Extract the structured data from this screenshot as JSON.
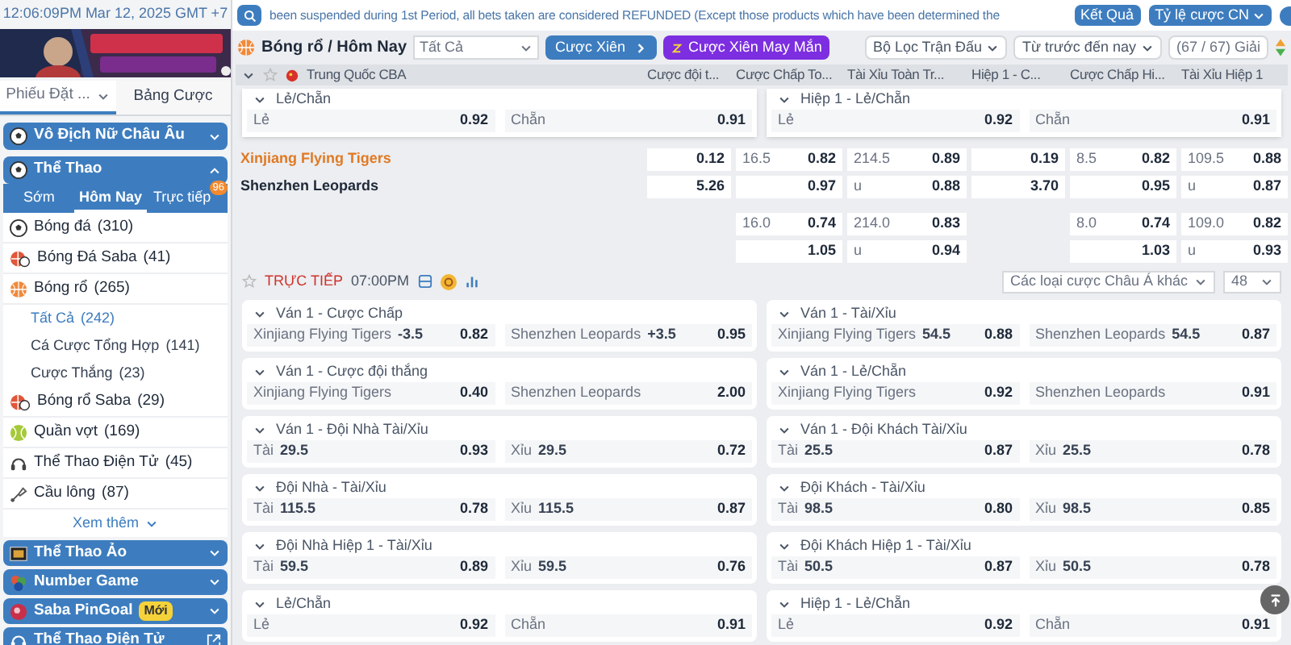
{
  "sidebar": {
    "clock": "12:06:09PM Mar 12, 2025 GMT +7",
    "tabs": [
      {
        "label": "Phiếu Đặt ...",
        "selected": true,
        "kind": "dropdown"
      },
      {
        "label": "Bảng Cược",
        "selected": false,
        "kind": "plain"
      }
    ],
    "sections": [
      {
        "title": "Vô Địch Nữ Châu Âu",
        "expanded": false
      },
      {
        "title": "Thể Thao",
        "expanded": true
      }
    ],
    "sport_tabs": [
      {
        "label": "Sớm",
        "selected": false
      },
      {
        "label": "Hôm Nay",
        "selected": true
      },
      {
        "label": "Trực tiếp",
        "selected": false,
        "badge": "96"
      }
    ],
    "sports": [
      {
        "name": "Bóng đá",
        "count": "(310)",
        "kind": "soccer"
      },
      {
        "name": "Bóng Đá Saba",
        "count": "(41)",
        "kind": "saba"
      },
      {
        "name": "Bóng rổ",
        "count": "(265)",
        "kind": "basketball",
        "children": [
          {
            "name": "Tất Cả",
            "count": "(242)",
            "selected": true
          },
          {
            "name": "Cá Cược Tổng Hợp",
            "count": "(141)",
            "selected": false
          },
          {
            "name": "Cược Thắng",
            "count": "(23)",
            "selected": false
          }
        ]
      },
      {
        "name": "Bóng rổ Saba",
        "count": "(29)",
        "kind": "saba"
      },
      {
        "name": "Quần vợt",
        "count": "(169)",
        "kind": "tennis"
      },
      {
        "name": "Thể Thao Điện Tử",
        "count": "(45)",
        "kind": "esports"
      },
      {
        "name": "Cầu lông",
        "count": "(87)",
        "kind": "badminton"
      }
    ],
    "more": "Xem thêm",
    "groups": [
      {
        "title": "Thể Thao Ảo",
        "kind": "collapsible"
      },
      {
        "title": "Number Game",
        "kind": "collapsible"
      },
      {
        "title": "Saba PinGoal",
        "kind": "collapsible",
        "badge": "Mới"
      },
      {
        "title": "Thể Thao Điện Tử",
        "kind": "link"
      }
    ]
  },
  "notice": "been suspended during 1st Period, all bets taken are considered REFUNDED (Except those products which have been determined the",
  "top_buttons": [
    {
      "label": "Kết Quả",
      "kind": "plain"
    },
    {
      "label": "Tỷ lệ cược CN",
      "kind": "dropdown"
    }
  ],
  "toolbar": {
    "title": "Bóng rổ / Hôm Nay",
    "sport_filter": "Tất Cả",
    "parlay": "Cược Xiên",
    "lucky_parlay": "Cược Xiên May Mắn",
    "match_filter": "Bộ Lọc Trận Đấu",
    "period": "Từ trước đến nay",
    "league_count": "(67 / 67) Giải"
  },
  "league": {
    "name": "Trung Quốc CBA",
    "columns": [
      "Cược đội t...",
      "Cược Chấp To...",
      "Tài Xỉu Toàn Tr...",
      "Hiệp 1 - C...",
      "Cược Chấp Hi...",
      "Tài Xỉu Hiệp 1"
    ]
  },
  "popup_markets": [
    {
      "title": "Lẻ/Chẵn",
      "outcomes": [
        {
          "label": "Lẻ",
          "odds": "0.92"
        },
        {
          "label": "Chẵn",
          "odds": "0.91"
        }
      ]
    },
    {
      "title": "Hiệp 1 - Lẻ/Chẵn",
      "outcomes": [
        {
          "label": "Lẻ",
          "odds": "0.92"
        },
        {
          "label": "Chẵn",
          "odds": "0.91"
        }
      ]
    }
  ],
  "match": {
    "teams": [
      {
        "name": "Xinjiang Flying Tigers",
        "favorite": true
      },
      {
        "name": "Shenzhen Leopards",
        "favorite": false
      }
    ],
    "rows": [
      [
        {
          "odds": "0.12"
        },
        {
          "line": "16.5",
          "odds": "0.82"
        },
        {
          "line": "214.5",
          "odds": "0.89"
        },
        {
          "odds": "0.19"
        },
        {
          "line": "8.5",
          "odds": "0.82"
        },
        {
          "line": "109.5",
          "odds": "0.88"
        }
      ],
      [
        {
          "odds": "5.26"
        },
        {
          "odds": "0.97"
        },
        {
          "line": "u",
          "odds": "0.88"
        },
        {
          "odds": "3.70"
        },
        {
          "odds": "0.95"
        },
        {
          "line": "u",
          "odds": "0.87"
        }
      ],
      [
        {},
        {
          "line": "16.0",
          "odds": "0.74"
        },
        {
          "line": "214.0",
          "odds": "0.83"
        },
        {},
        {
          "line": "8.0",
          "odds": "0.74"
        },
        {
          "line": "109.0",
          "odds": "0.82"
        }
      ],
      [
        {},
        {
          "odds": "1.05"
        },
        {
          "line": "u",
          "odds": "0.94"
        },
        {},
        {
          "odds": "1.03"
        },
        {
          "line": "u",
          "odds": "0.93"
        }
      ]
    ]
  },
  "live": {
    "status": "TRỰC TIẾP",
    "time": "07:00PM",
    "market_filter": "Các loại cược Châu Á khác",
    "count": "48"
  },
  "markets": [
    {
      "title": "Ván 1 - Cược Chấp",
      "outcomes": [
        {
          "label": "Xinjiang Flying Tigers",
          "line": "-3.5",
          "odds": "0.82"
        },
        {
          "label": "Shenzhen Leopards",
          "line": "+3.5",
          "odds": "0.95"
        }
      ]
    },
    {
      "title": "Ván 1 - Tài/Xỉu",
      "outcomes": [
        {
          "label": "Xinjiang Flying Tigers",
          "line": "54.5",
          "odds": "0.88"
        },
        {
          "label": "Shenzhen Leopards",
          "line": "54.5",
          "odds": "0.87"
        }
      ]
    },
    {
      "title": "Ván 1 - Cược đội thắng",
      "outcomes": [
        {
          "label": "Xinjiang Flying Tigers",
          "odds": "0.40"
        },
        {
          "label": "Shenzhen Leopards",
          "odds": "2.00"
        }
      ]
    },
    {
      "title": "Ván 1 - Lẻ/Chẵn",
      "outcomes": [
        {
          "label": "Xinjiang Flying Tigers",
          "odds": "0.92"
        },
        {
          "label": "Shenzhen Leopards",
          "odds": "0.91"
        }
      ]
    },
    {
      "title": "Ván 1 - Đội Nhà Tài/Xỉu",
      "outcomes": [
        {
          "label": "Tài",
          "line": "29.5",
          "odds": "0.93"
        },
        {
          "label": "Xỉu",
          "line": "29.5",
          "odds": "0.72"
        }
      ]
    },
    {
      "title": "Ván 1 - Đội Khách Tài/Xỉu",
      "outcomes": [
        {
          "label": "Tài",
          "line": "25.5",
          "odds": "0.87"
        },
        {
          "label": "Xỉu",
          "line": "25.5",
          "odds": "0.78"
        }
      ]
    },
    {
      "title": "Đội Nhà - Tài/Xỉu",
      "outcomes": [
        {
          "label": "Tài",
          "line": "115.5",
          "odds": "0.78"
        },
        {
          "label": "Xỉu",
          "line": "115.5",
          "odds": "0.87"
        }
      ]
    },
    {
      "title": "Đội Khách - Tài/Xỉu",
      "outcomes": [
        {
          "label": "Tài",
          "line": "98.5",
          "odds": "0.80"
        },
        {
          "label": "Xỉu",
          "line": "98.5",
          "odds": "0.85"
        }
      ]
    },
    {
      "title": "Đội Nhà Hiệp 1 - Tài/Xỉu",
      "outcomes": [
        {
          "label": "Tài",
          "line": "59.5",
          "odds": "0.89"
        },
        {
          "label": "Xỉu",
          "line": "59.5",
          "odds": "0.76"
        }
      ]
    },
    {
      "title": "Đội Khách Hiệp 1 - Tài/Xỉu",
      "outcomes": [
        {
          "label": "Tài",
          "line": "50.5",
          "odds": "0.87"
        },
        {
          "label": "Xỉu",
          "line": "50.5",
          "odds": "0.78"
        }
      ]
    },
    {
      "title": "Lẻ/Chẵn",
      "outcomes": [
        {
          "label": "Lẻ",
          "odds": "0.92"
        },
        {
          "label": "Chẵn",
          "odds": "0.91"
        }
      ]
    },
    {
      "title": "Hiệp 1 - Lẻ/Chẵn",
      "outcomes": [
        {
          "label": "Lẻ",
          "odds": "0.92"
        },
        {
          "label": "Chẵn",
          "odds": "0.91"
        }
      ]
    }
  ]
}
